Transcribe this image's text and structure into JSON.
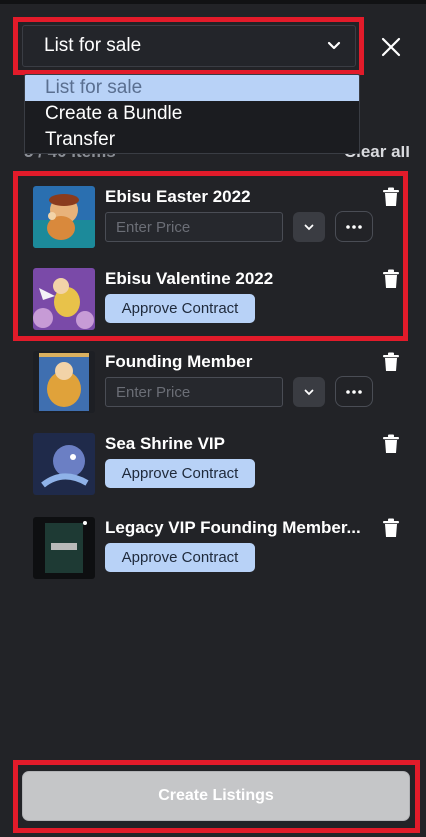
{
  "header": {
    "selected": "List for sale",
    "options": [
      "List for sale",
      "Create a Bundle",
      "Transfer"
    ]
  },
  "summary": {
    "count_text": "5 / 40 items",
    "clear_label": "Clear all"
  },
  "items": [
    {
      "title": "Ebisu Easter 2022",
      "action": "price",
      "placeholder": "Enter Price"
    },
    {
      "title": "Ebisu Valentine 2022",
      "action": "approve",
      "approve_label": "Approve Contract"
    },
    {
      "title": "Founding Member",
      "action": "price",
      "placeholder": "Enter Price"
    },
    {
      "title": "Sea Shrine VIP",
      "action": "approve",
      "approve_label": "Approve Contract"
    },
    {
      "title": "Legacy VIP Founding Member...",
      "action": "approve",
      "approve_label": "Approve Contract"
    }
  ],
  "footer": {
    "cta_label": "Create Listings"
  },
  "icons": {
    "close": "close-icon",
    "chevron": "chevron-down-icon",
    "more": "more-dots-icon",
    "trash": "trash-icon"
  },
  "colors": {
    "background": "#222327",
    "highlight": "#e21b2a",
    "accent": "#b8d2f7",
    "cta_disabled": "#c5c6c8"
  }
}
